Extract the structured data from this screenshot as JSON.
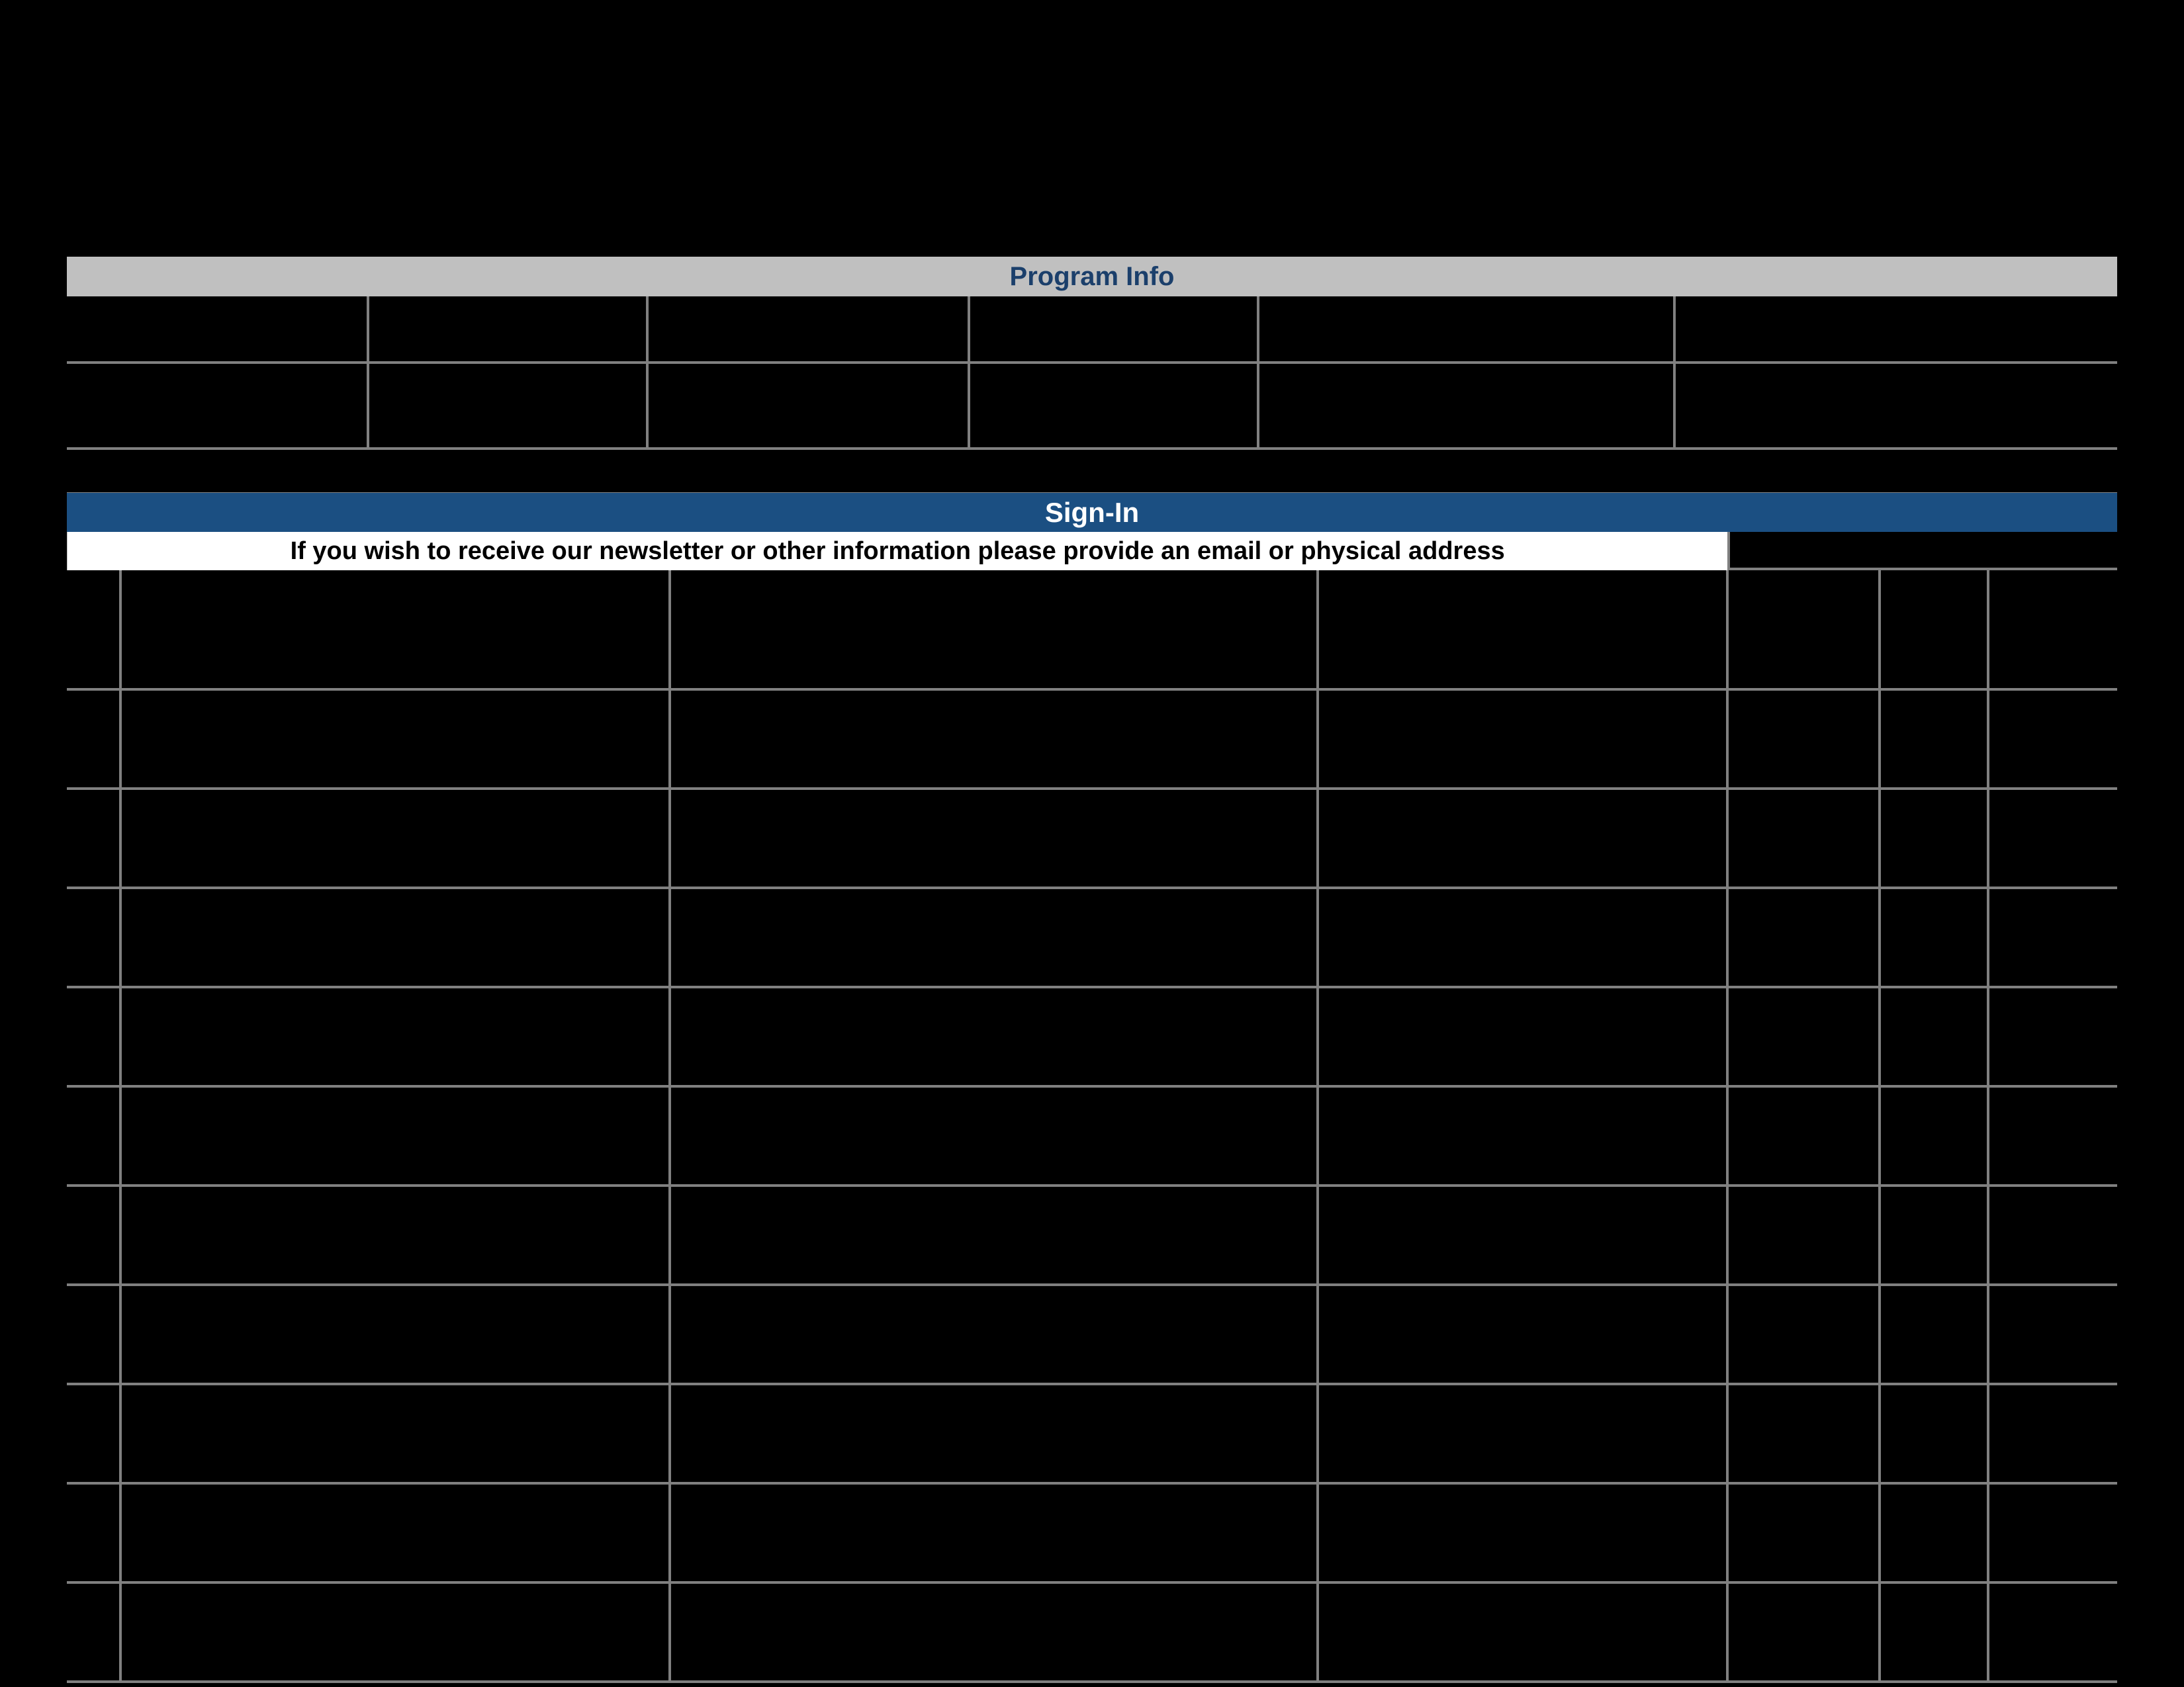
{
  "headers": {
    "program_info": "Program Info",
    "sign_in": "Sign-In"
  },
  "note": "If you wish to receive our newsletter or other information please provide an email or physical address",
  "program_info": {
    "rows": 2,
    "cols": 6
  },
  "sign_in_table": {
    "rows": 11,
    "cols": 7
  }
}
